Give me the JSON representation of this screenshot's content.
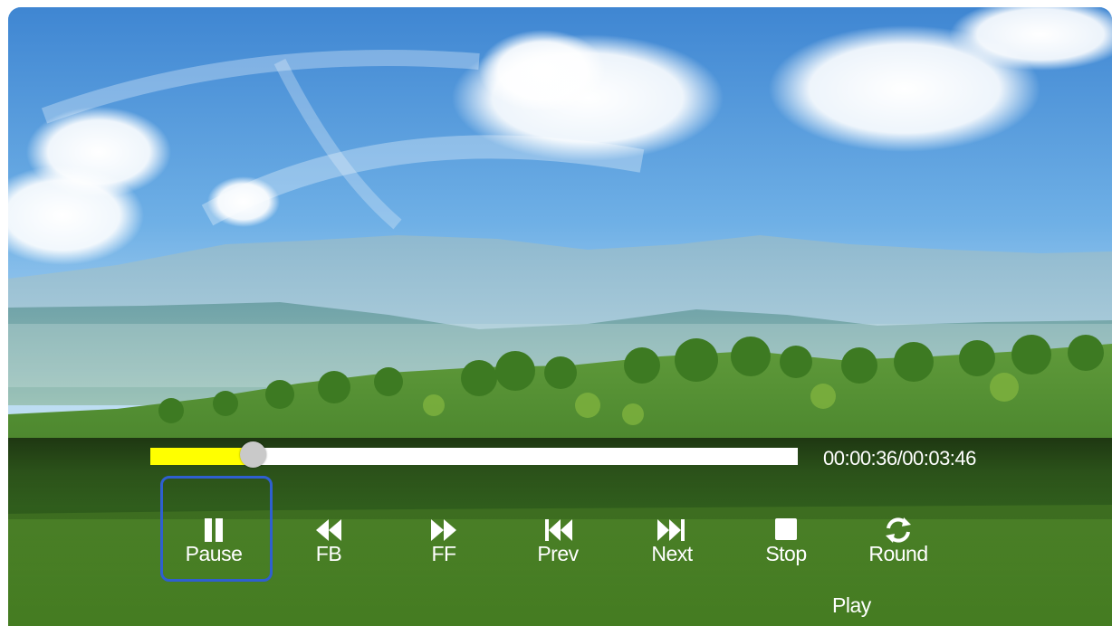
{
  "player": {
    "time_display": "00:00:36/00:03:46",
    "progress_fraction": 0.159,
    "play_mode": "Play",
    "focused_control": "pause"
  },
  "controls": {
    "pause": {
      "label": "Pause",
      "icon": "pause-icon"
    },
    "fb": {
      "label": "FB",
      "icon": "fast-backward-icon"
    },
    "ff": {
      "label": "FF",
      "icon": "fast-forward-icon"
    },
    "prev": {
      "label": "Prev",
      "icon": "skip-previous-icon"
    },
    "next": {
      "label": "Next",
      "icon": "skip-next-icon"
    },
    "stop": {
      "label": "Stop",
      "icon": "stop-icon"
    },
    "round": {
      "label": "Round",
      "icon": "repeat-icon"
    }
  },
  "colors": {
    "progress_fill": "#ffff00",
    "progress_track": "#ffffff",
    "focus_border": "#2f5fd0"
  }
}
